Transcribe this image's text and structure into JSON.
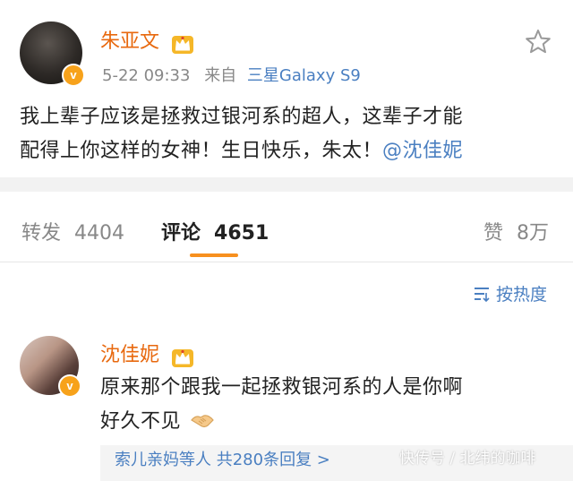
{
  "post": {
    "author": "朱亚文",
    "time": "5-22 09:33",
    "source_prefix": "来自",
    "device": "三星Galaxy S9",
    "content_line1": "我上辈子应该是拯救过银河系的超人，这辈子才能",
    "content_line2": "配得上你这样的女神！生日快乐，朱太！",
    "mention": "@沈佳妮"
  },
  "tabs": [
    {
      "label": "转发",
      "count": "4404"
    },
    {
      "label": "评论",
      "count": "4651"
    },
    {
      "label": "赞",
      "count": "8万"
    }
  ],
  "sort": {
    "label": "按热度"
  },
  "comment": {
    "author": "沈佳妮",
    "line1": "原来那个跟我一起拯救银河系的人是你啊",
    "line2": "好久不见",
    "reply_strip": "索儿亲妈等人  共280条回复 >"
  },
  "watermark": "快传号 / 北纬的咖啡",
  "colors": {
    "username": "#e8690f",
    "link": "#4a7fc1",
    "accent_underline": "#f7901e",
    "verified_badge": "#f7a21b"
  },
  "icons": [
    "verified-badge-icon",
    "crown-icon",
    "star-icon",
    "sort-icon",
    "handshake-icon"
  ]
}
